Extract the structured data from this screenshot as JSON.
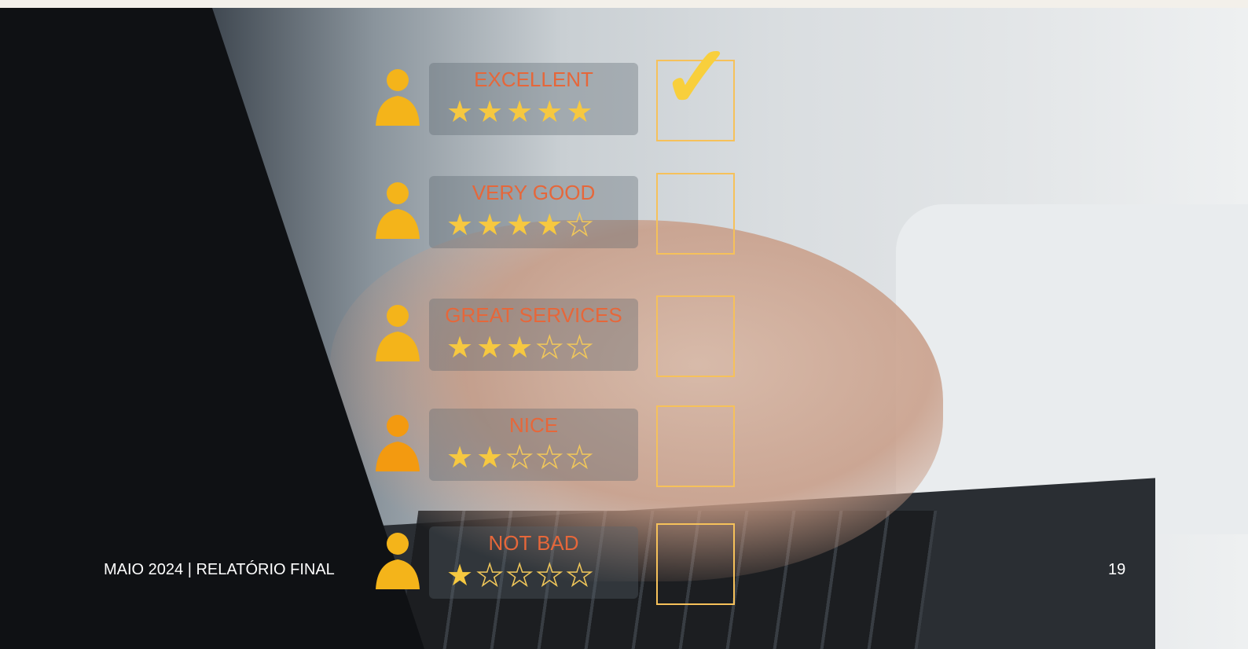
{
  "ratings": [
    {
      "label": "EXCELLENT",
      "filled": 5,
      "total": 5,
      "checked": true
    },
    {
      "label": "VERY GOOD",
      "filled": 4,
      "total": 5,
      "checked": false
    },
    {
      "label": "GREAT SERVICES",
      "filled": 3,
      "total": 5,
      "checked": false
    },
    {
      "label": "NICE",
      "filled": 2,
      "total": 5,
      "checked": false
    },
    {
      "label": "NOT BAD",
      "filled": 1,
      "total": 5,
      "checked": false
    }
  ],
  "footer": {
    "left_text": "MAIO 2024 | RELATÓRIO FINAL",
    "page_number": "19"
  },
  "colors": {
    "label": "#e6673a",
    "star": "#f6c840",
    "person": "#f4b41a",
    "frame": "#f6c15a",
    "footer_text": "#ffffff"
  },
  "icons": {
    "person": "person-icon",
    "star": "star-icon",
    "check": "checkmark-icon"
  }
}
